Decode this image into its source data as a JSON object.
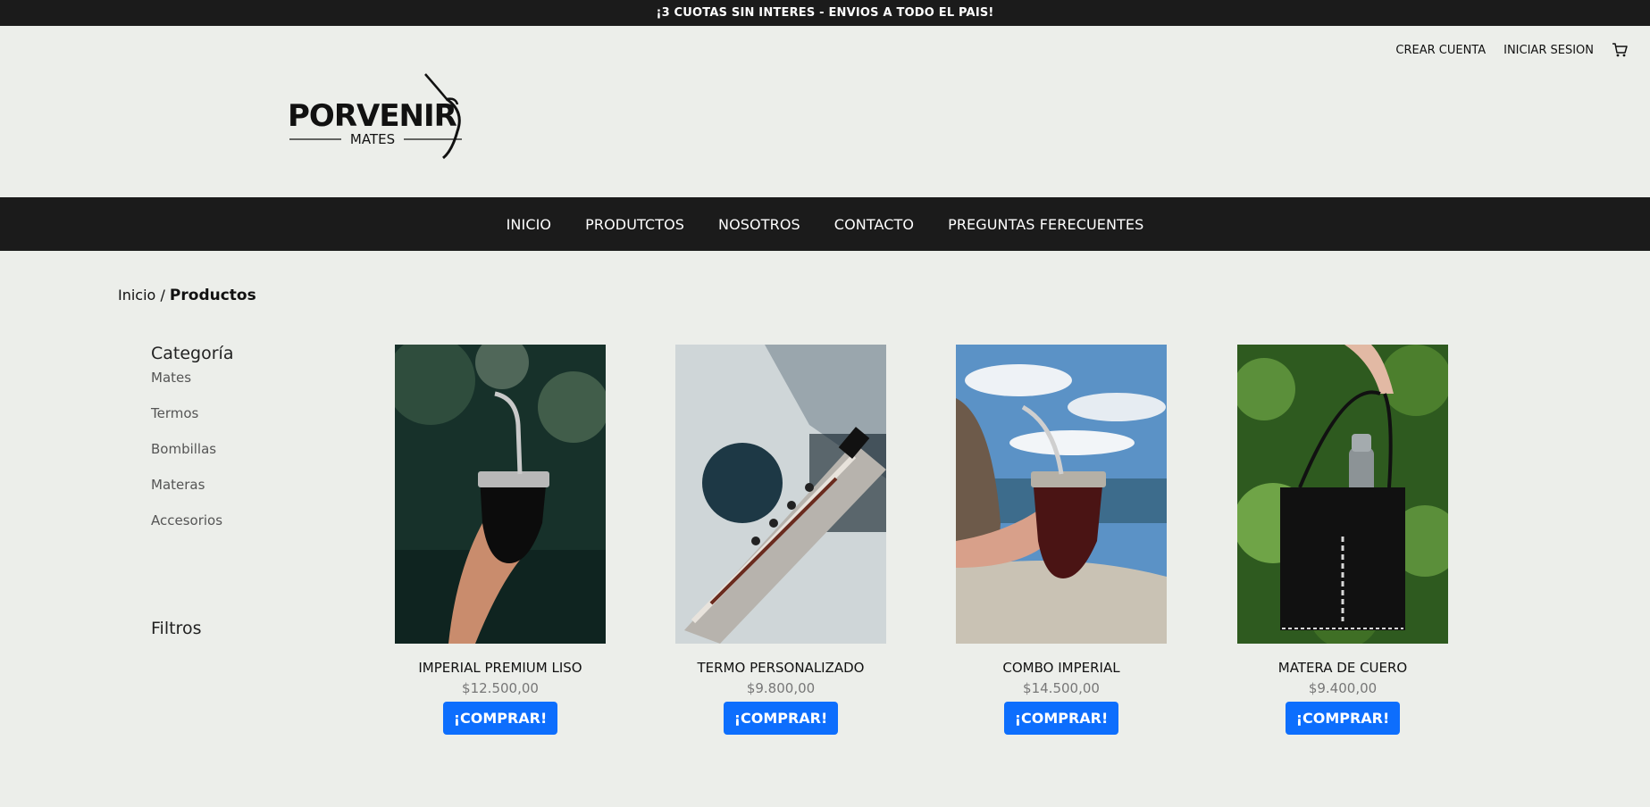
{
  "announcement": "¡3 CUOTAS SIN INTERES - ENVIOS A TODO EL PAIS!",
  "logo": {
    "brand": "PORVENIR",
    "sub": "MATES"
  },
  "account": {
    "create": "CREAR CUENTA",
    "login": "INICIAR SESION",
    "cart_icon": "cart-icon"
  },
  "nav": [
    {
      "label": "INICIO"
    },
    {
      "label": "PRODUTCTOS"
    },
    {
      "label": "NOSOTROS"
    },
    {
      "label": "CONTACTO"
    },
    {
      "label": "PREGUNTAS FERECUENTES"
    }
  ],
  "breadcrumb": {
    "home": "Inicio",
    "sep": "/",
    "current": "Productos"
  },
  "sidebar": {
    "category_title": "Categoría",
    "categories": [
      "Mates",
      "Termos",
      "Bombillas",
      "Materas",
      "Accesorios"
    ],
    "filters_title": "Filtros"
  },
  "products": [
    {
      "name": "IMPERIAL PREMIUM LISO",
      "price": "$12.500,00",
      "button": "¡COMPRAR!"
    },
    {
      "name": "TERMO PERSONALIZADO",
      "price": "$9.800,00",
      "button": "¡COMPRAR!"
    },
    {
      "name": "COMBO IMPERIAL",
      "price": "$14.500,00",
      "button": "¡COMPRAR!"
    },
    {
      "name": "MATERA DE CUERO",
      "price": "$9.400,00",
      "button": "¡COMPRAR!"
    }
  ],
  "colors": {
    "dark": "#1b1b1b",
    "background": "#eceeea",
    "button": "#0d6efd"
  }
}
